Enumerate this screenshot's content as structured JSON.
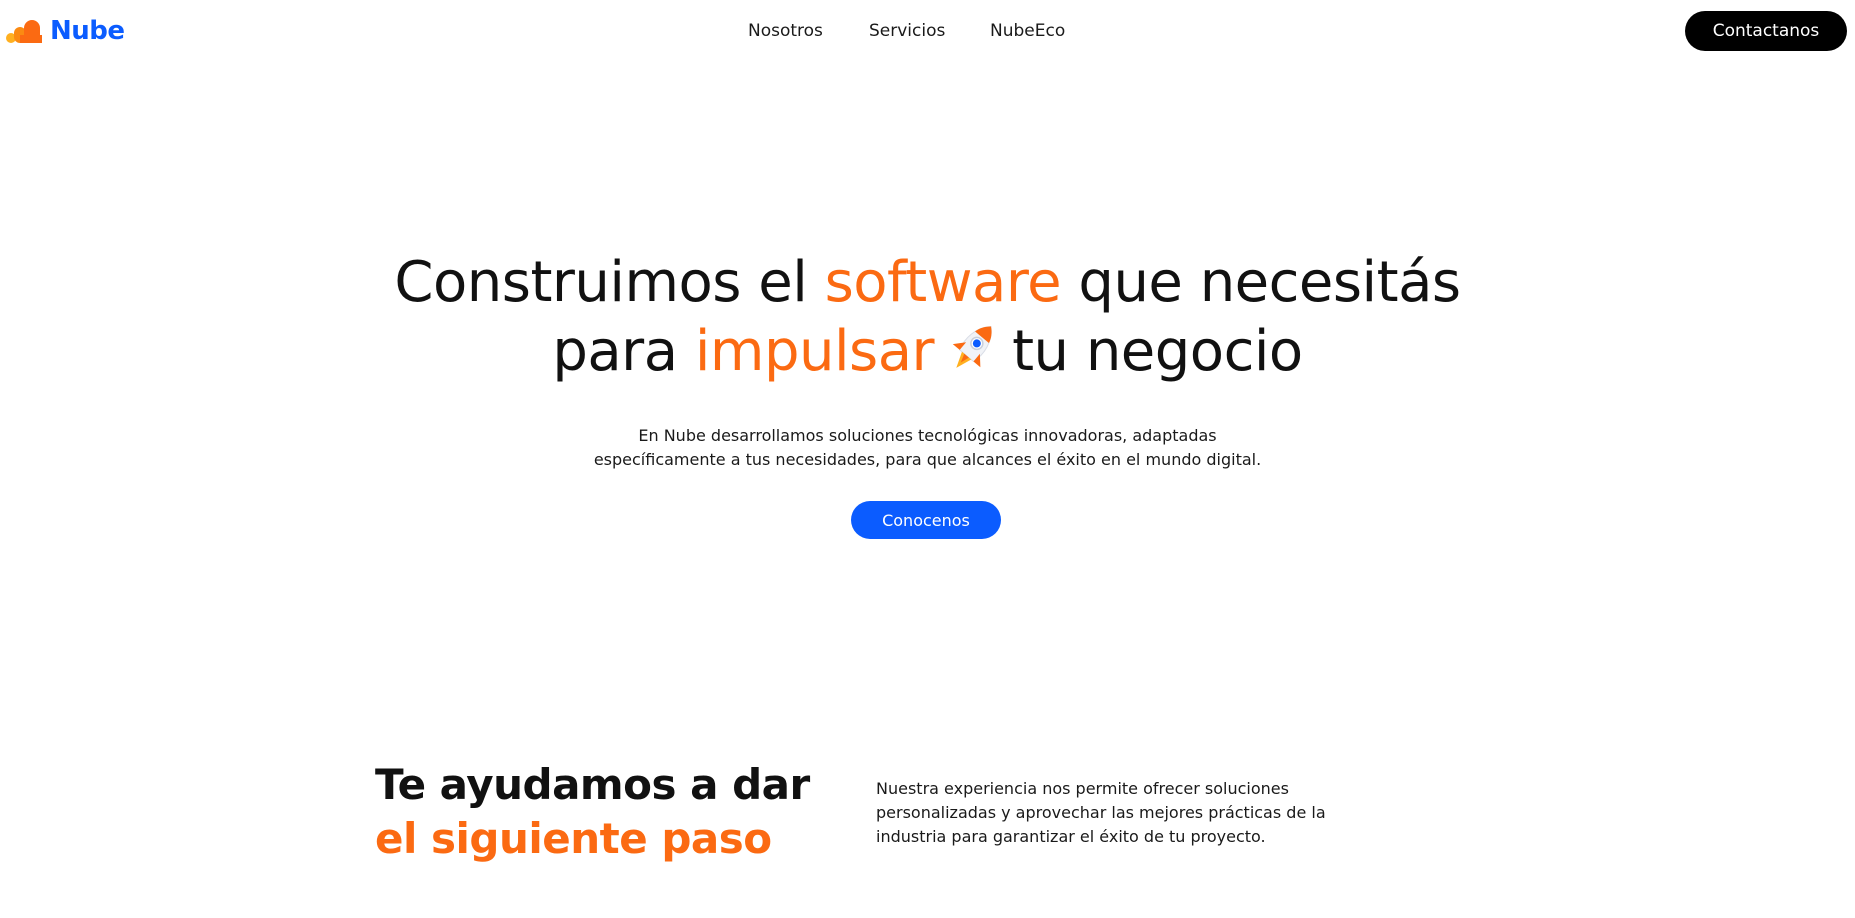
{
  "brand": {
    "name": "Nube",
    "logo_icon": "cloud-bars-logo-icon",
    "brand_color": "#0b5cff",
    "logo_colors": [
      "#ffb020",
      "#fb6a12"
    ]
  },
  "nav": {
    "links": [
      {
        "label": "Nosotros"
      },
      {
        "label": "Servicios"
      },
      {
        "label": "NubeEco"
      }
    ],
    "contact_label": "Contactanos"
  },
  "hero": {
    "title_part1": "Construimos el ",
    "title_accent1": "software",
    "title_part2": " que necesitás",
    "title_part3": "para ",
    "title_accent2": "impulsar",
    "title_part4": "tu negocio",
    "emoji_icon": "rocket-icon",
    "description_line1": "En Nube desarrollamos soluciones tecnológicas innovadoras, adaptadas",
    "description_line2": "específicamente a tus necesidades, para que alcances el éxito en el mundo digital.",
    "cta_label": "Conocenos",
    "accent_color": "#fb6a12",
    "cta_color": "#0b5cff"
  },
  "section": {
    "title_line1": "Te ayudamos a dar",
    "title_line2_accent": "el siguiente paso",
    "text_line1": "Nuestra experiencia nos permite ofrecer soluciones",
    "text_line2": "personalizadas y aprovechar las mejores prácticas de la",
    "text_line3": "industria para garantizar el éxito de tu proyecto."
  }
}
